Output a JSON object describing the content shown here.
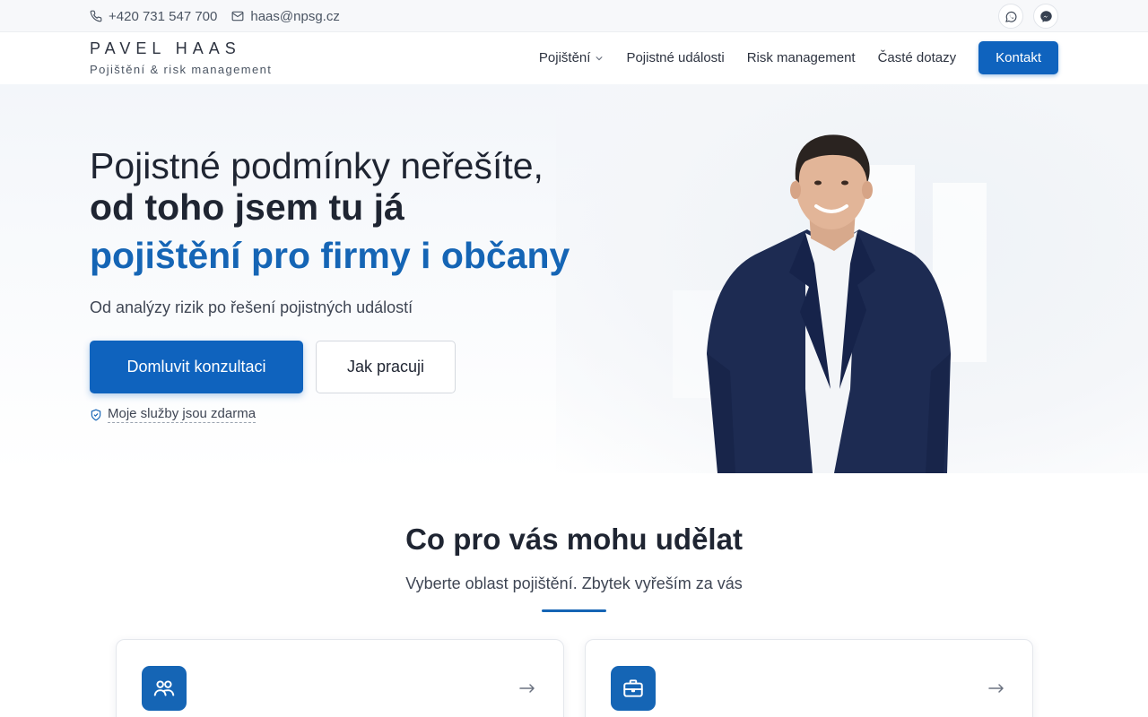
{
  "topbar": {
    "phone": "+420 731 547 700",
    "email": "haas@npsg.cz",
    "social": [
      "whatsapp-icon",
      "messenger-icon"
    ]
  },
  "header": {
    "brand_name": "PAVEL HAAS",
    "brand_sub": "Pojištění & risk management",
    "nav": [
      {
        "label": "Pojištění",
        "has_dropdown": true
      },
      {
        "label": "Pojistné události"
      },
      {
        "label": "Risk management"
      },
      {
        "label": "Časté dotazy"
      }
    ],
    "cta": "Kontakt"
  },
  "hero": {
    "title_line1": "Pojistné podmínky neřešíte,",
    "title_line2": "od toho jsem tu já",
    "title_accent": "pojištění pro firmy i občany",
    "subtitle": "Od analýzy rizik po řešení pojistných událostí",
    "primary_button": "Domluvit konzultaci",
    "secondary_button": "Jak pracuji",
    "free_note": "Moje služby jsou zdarma"
  },
  "services": {
    "title": "Co pro vás mohu udělat",
    "subtitle": "Vyberte oblast pojištění. Zbytek vyřeším za vás",
    "cards": [
      {
        "icon": "people-icon"
      },
      {
        "icon": "briefcase-icon"
      }
    ]
  },
  "colors": {
    "accent": "#0f63be",
    "accent_text": "#1565b5"
  }
}
